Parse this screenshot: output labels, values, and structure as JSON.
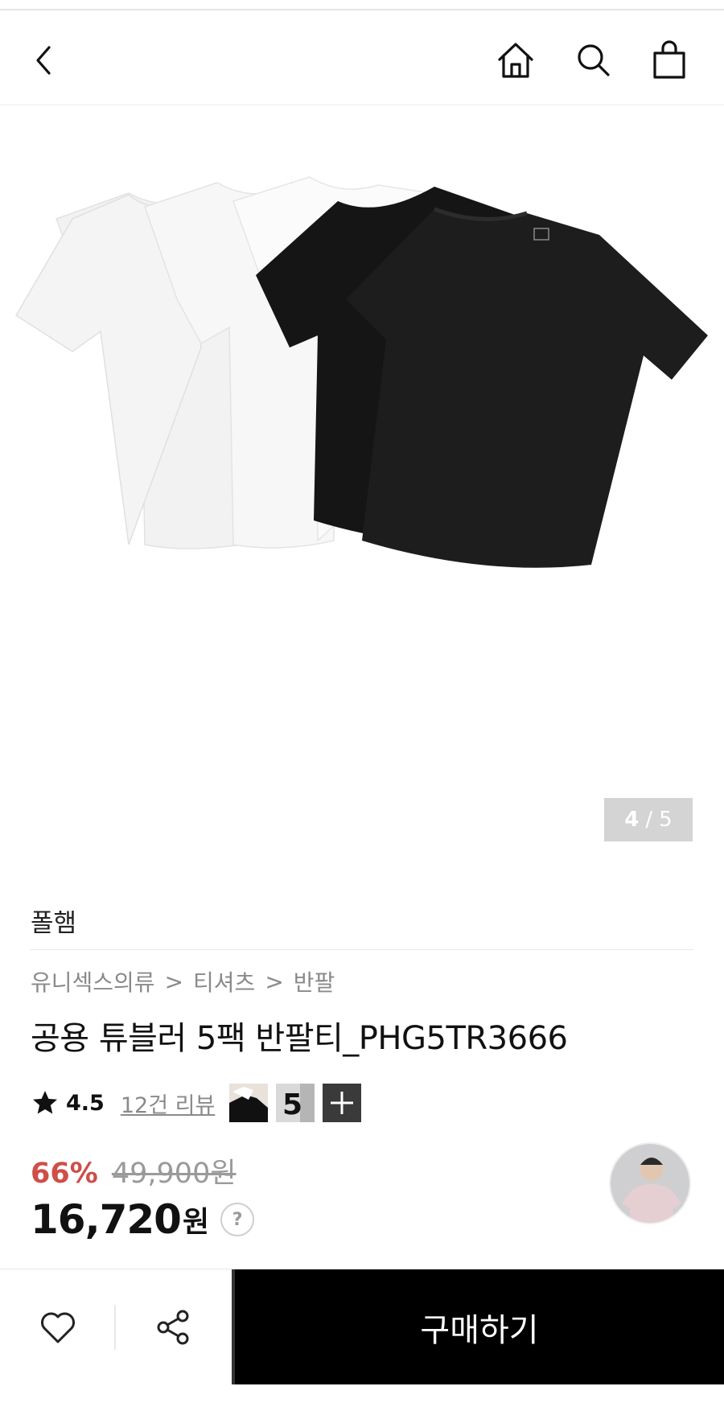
{
  "header": {
    "back_icon": "chevron-left-icon",
    "home_icon": "home-icon",
    "search_icon": "search-icon",
    "bag_icon": "shopping-bag-icon"
  },
  "gallery": {
    "current": "4",
    "separator": "/",
    "total": "5"
  },
  "product": {
    "brand": "폴햄",
    "breadcrumb": [
      "유니섹스의류",
      "티셔츠",
      "반팔"
    ],
    "breadcrumb_sep": ">",
    "title": "공용 튜블러 5팩 반팔티_PHG5TR3666",
    "rating": "4.5",
    "reviews_label": "12건 리뷰",
    "review_thumb_2_label": "5",
    "discount": "66%",
    "original_price": "49,900원",
    "final_price": "16,720",
    "currency": "원",
    "help_label": "?"
  },
  "bottom_bar": {
    "wishlist_icon": "heart-icon",
    "share_icon": "share-icon",
    "buy_label": "구매하기"
  },
  "colors": {
    "accent_discount": "#cf4e48",
    "buy_button_bg": "#000000",
    "counter_bg": "#d4d4d4"
  }
}
